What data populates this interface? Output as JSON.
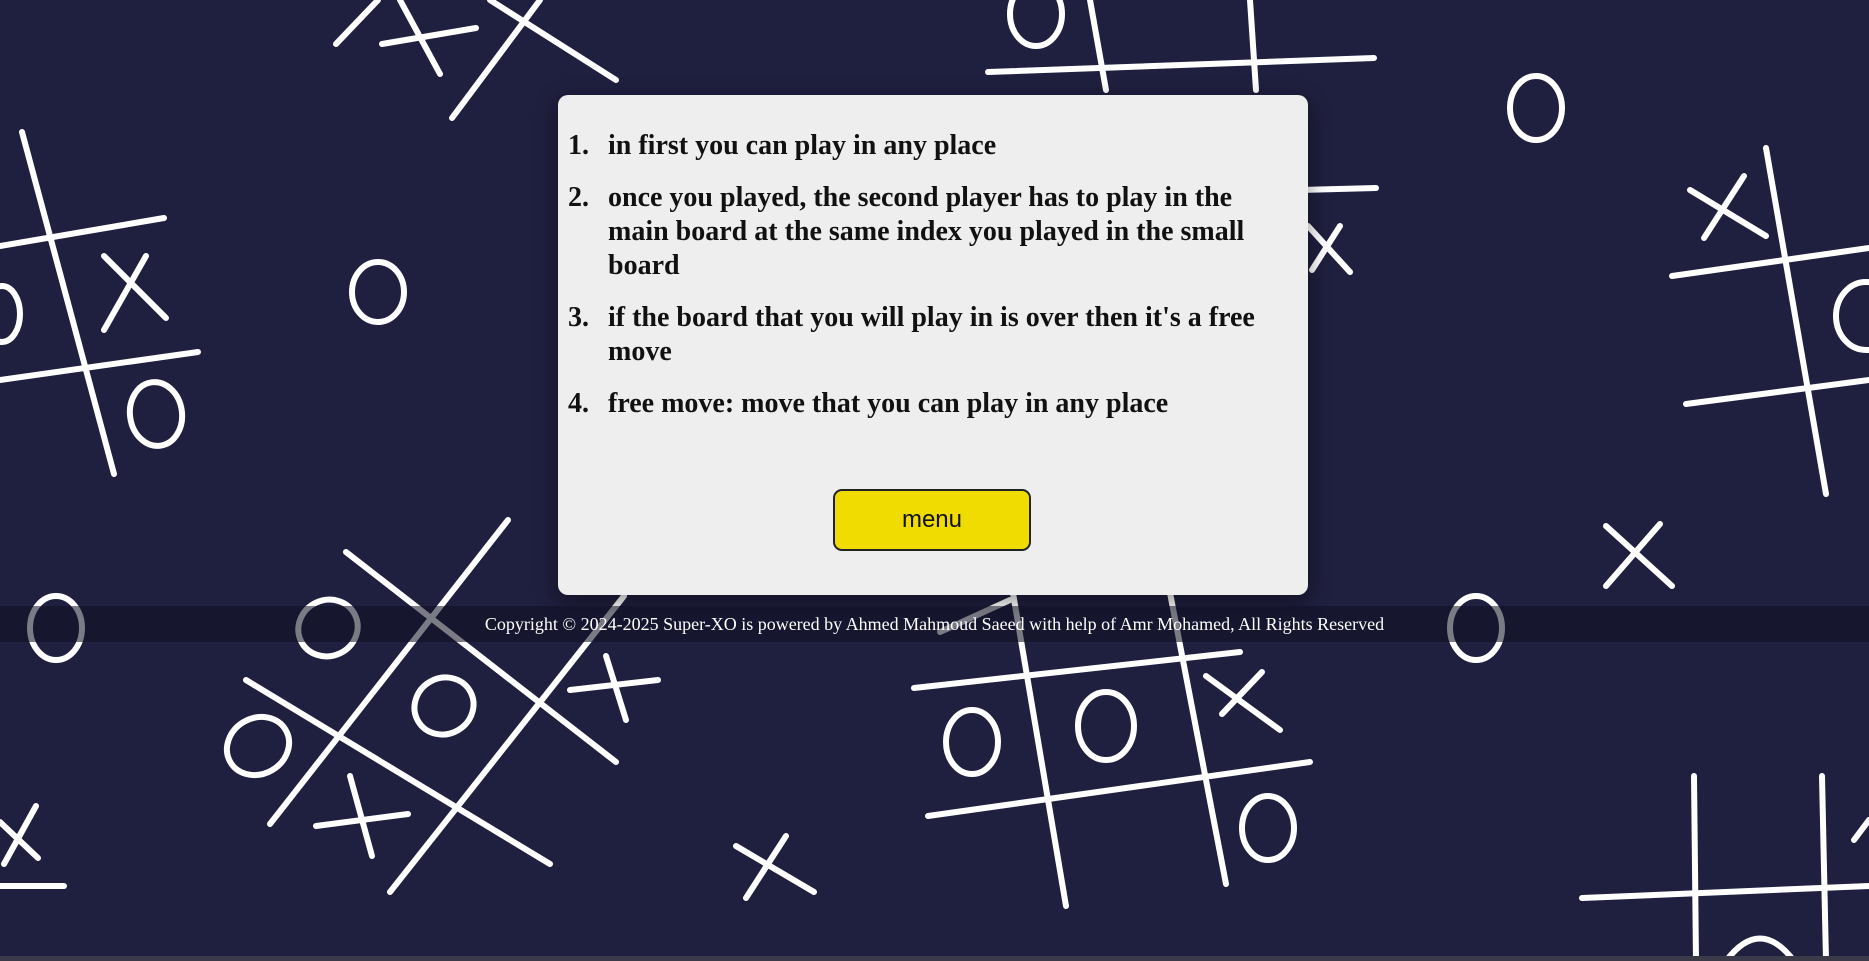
{
  "rules": {
    "items": [
      "in first you can play in any place",
      "once you played, the second player has to play in the main board at the same index you played in the small board",
      "if the board that you will play in is over then it's a free move",
      "free move: move that you can play in any place"
    ],
    "menu_label": "menu"
  },
  "footer": {
    "copyright": "Copyright © 2024-2025 Super-XO is powered by Ahmed Mahmoud Saeed with help of Amr Mohamed, All Rights Reserved"
  },
  "colors": {
    "background": "#1f1f3f",
    "card": "#eeeeee",
    "button": "#f0dc00",
    "doodle": "#ffffff"
  },
  "icons": {
    "background": "tic-tac-toe-doodle-pattern"
  }
}
